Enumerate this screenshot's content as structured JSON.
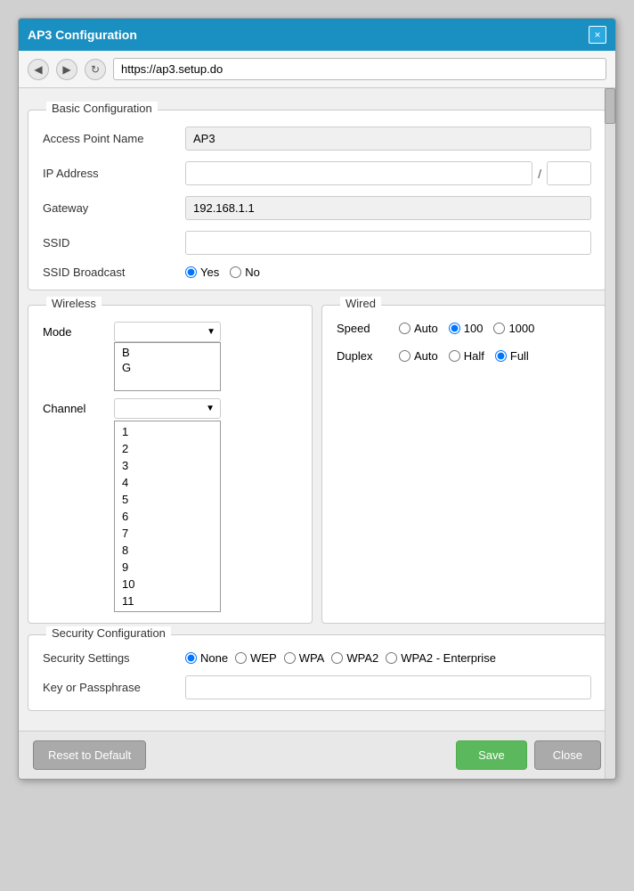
{
  "titleBar": {
    "title": "AP3 Configuration",
    "closeLabel": "×"
  },
  "navBar": {
    "url": "https://ap3.setup.do",
    "backIcon": "◀",
    "forwardIcon": "▶",
    "refreshIcon": "↻"
  },
  "basicConfig": {
    "sectionTitle": "Basic Configuration",
    "apnLabel": "Access Point Name",
    "apnValue": "AP3",
    "ipLabel": "IP Address",
    "ipValue": "",
    "ipSlash": "/",
    "ipSuffix": "",
    "gatewayLabel": "Gateway",
    "gatewayValue": "192.168.1.1",
    "ssidLabel": "SSID",
    "ssidValue": "",
    "ssidBroadcastLabel": "SSID Broadcast",
    "ssidBroadcastOptions": [
      "Yes",
      "No"
    ],
    "ssidBroadcastSelected": "Yes"
  },
  "wireless": {
    "sectionTitle": "Wireless",
    "modeLabel": "Mode",
    "modeOptions": [
      "B",
      "G"
    ],
    "channelLabel": "Channel",
    "channelOptions": [
      "1",
      "2",
      "3",
      "4",
      "5",
      "6",
      "7",
      "8",
      "9",
      "10",
      "11"
    ]
  },
  "wired": {
    "sectionTitle": "Wired",
    "speedLabel": "Speed",
    "speedOptions": [
      "Auto",
      "100",
      "1000"
    ],
    "speedSelected": "100",
    "duplexLabel": "Duplex",
    "duplexOptions": [
      "Auto",
      "Half",
      "Full"
    ],
    "duplexSelected": "Full"
  },
  "securityConfig": {
    "sectionTitle": "Security Configuration",
    "settingsLabel": "Security Settings",
    "settingsOptions": [
      "None",
      "WEP",
      "WPA",
      "WPA2",
      "WPA2 - Enterprise"
    ],
    "settingsSelected": "None",
    "keyLabel": "Key or Passphrase",
    "keyValue": ""
  },
  "footer": {
    "resetLabel": "Reset to Default",
    "saveLabel": "Save",
    "closeLabel": "Close"
  }
}
